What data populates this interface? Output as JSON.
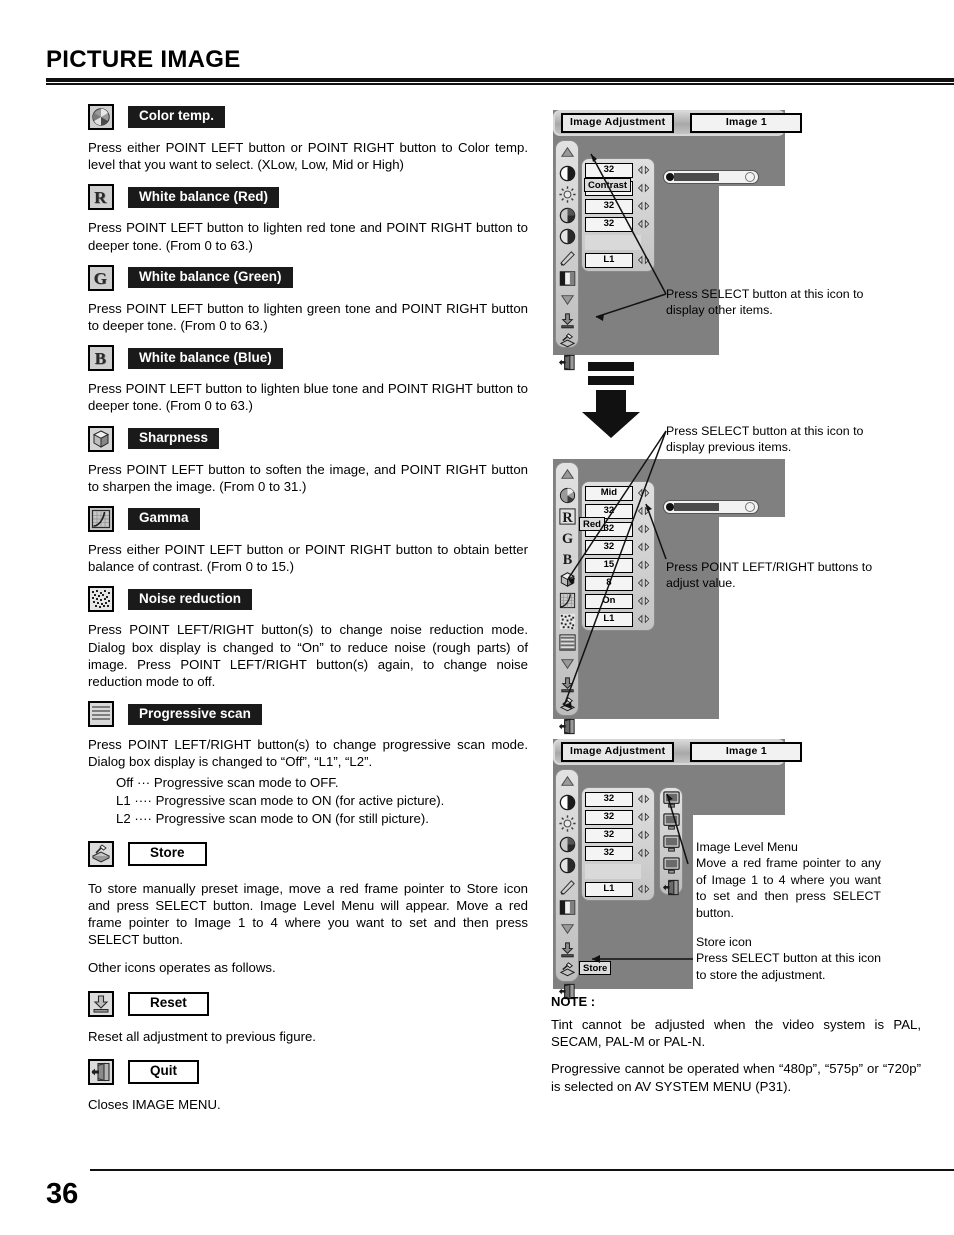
{
  "page": {
    "title": "PICTURE IMAGE",
    "number": "36"
  },
  "sections": [
    {
      "icon": "color-temp-icon",
      "label": "Color temp.",
      "label_style": "black",
      "body": "Press either POINT LEFT button or POINT RIGHT button to Color temp. level that you want to select. (XLow, Low, Mid or High)"
    },
    {
      "icon": "white-balance-red-icon",
      "label": "White balance (Red)",
      "label_style": "black",
      "body": "Press POINT LEFT button to lighten red tone and POINT RIGHT button to deeper tone.  (From 0 to 63.)"
    },
    {
      "icon": "white-balance-green-icon",
      "label": "White balance (Green)",
      "label_style": "black",
      "body": "Press POINT LEFT button to lighten green tone and POINT RIGHT button to deeper tone.  (From 0 to 63.)"
    },
    {
      "icon": "white-balance-blue-icon",
      "label": "White balance (Blue)",
      "label_style": "black",
      "body": "Press POINT LEFT button to lighten blue tone and POINT RIGHT button to deeper tone.  (From 0 to 63.)"
    },
    {
      "icon": "sharpness-icon",
      "label": "Sharpness",
      "label_style": "black",
      "body": "Press POINT LEFT button to soften the image, and POINT RIGHT button to sharpen the image.  (From 0 to 31.)"
    },
    {
      "icon": "gamma-icon",
      "label": "Gamma",
      "label_style": "black",
      "body": "Press either POINT LEFT button or POINT RIGHT button to obtain better balance of contrast.  (From 0 to 15.)"
    },
    {
      "icon": "noise-reduction-icon",
      "label": "Noise reduction",
      "label_style": "black",
      "body": "Press POINT LEFT/RIGHT button(s) to change noise reduction mode.  Dialog box display is changed to “On” to reduce noise (rough parts) of  image. Press POINT LEFT/RIGHT button(s) again, to change noise reduction mode to off."
    },
    {
      "icon": "progressive-scan-icon",
      "label": "Progressive scan",
      "label_style": "black",
      "body": "Press POINT LEFT/RIGHT button(s) to change progressive scan mode.  Dialog box display is changed to “Off”, “L1”, “L2”.",
      "sub_lines": [
        "Off  ···  Progressive scan mode to OFF.",
        "L1  ····  Progressive scan mode to ON (for active picture).",
        "L2  ····  Progressive scan mode to ON (for still picture)."
      ]
    },
    {
      "icon": "store-icon",
      "label": "Store",
      "label_style": "box",
      "body": "To store manually preset image, move a red frame pointer to Store icon and press SELECT button.  Image Level Menu will appear. Move a red frame pointer to Image 1 to 4 where you want to set and then press SELECT button.",
      "after": "Other icons operates as follows."
    },
    {
      "icon": "reset-icon",
      "label": "Reset",
      "label_style": "box",
      "body": "Reset all adjustment to previous figure."
    },
    {
      "icon": "quit-icon",
      "label": "Quit",
      "label_style": "box",
      "body": "Closes IMAGE MENU."
    }
  ],
  "osd_top": {
    "title_button": "Image Adjustment",
    "image_button": "Image 1",
    "values": [
      "32",
      "",
      "32",
      "32",
      "L1"
    ],
    "tooltip": "Contrast",
    "callout": "Press SELECT button at this icon to display other items.",
    "side_icons": [
      "scroll-up-icon",
      "contrast-icon",
      "brightness-icon",
      "color-icon",
      "tint-icon",
      "pencil-icon",
      "white-balance-icon",
      "scroll-down-icon",
      "reset-icon",
      "store-icon",
      "quit-icon"
    ]
  },
  "osd_mid": {
    "values": [
      "Mid",
      "32",
      "32",
      "32",
      "15",
      "8",
      "On",
      "L1"
    ],
    "tooltip": "Red",
    "callout_top": "Press SELECT button at this icon to display previous items.",
    "callout_right": "Press POINT LEFT/RIGHT buttons to adjust value.",
    "side_icons": [
      "scroll-up-icon",
      "color-temp-icon",
      "red-icon",
      "green-icon",
      "blue-icon",
      "sharpness-icon",
      "gamma-icon",
      "noise-reduction-icon",
      "progressive-scan-icon",
      "scroll-down-icon",
      "reset-icon",
      "store-icon",
      "quit-icon"
    ]
  },
  "osd_bottom": {
    "title_button": "Image Adjustment",
    "image_button": "Image 1",
    "values": [
      "32",
      "32",
      "32",
      "32",
      "L1"
    ],
    "tooltip": "Store",
    "callout_image_level_title": "Image Level Menu",
    "callout_image_level_body": "Move a red frame pointer to any of Image 1 to 4 where you want to set  and then press SELECT button.",
    "callout_store_title": "Store icon",
    "callout_store_body": "Press SELECT button at this icon to store the adjustment.",
    "level_icons": [
      "image-1-icon",
      "image-2-icon",
      "image-3-icon",
      "image-4-icon",
      "quit-icon"
    ]
  },
  "note": {
    "heading": "NOTE :",
    "paragraphs": [
      "Tint cannot be adjusted when the video system is PAL, SECAM, PAL-M or PAL-N.",
      "Progressive cannot be operated when “480p”, “575p” or “720p” is selected on AV SYSTEM MENU (P31)."
    ]
  },
  "colors": {
    "osd_background": "#808080",
    "label_background": "#1a1a1a",
    "ink": "#000000"
  }
}
